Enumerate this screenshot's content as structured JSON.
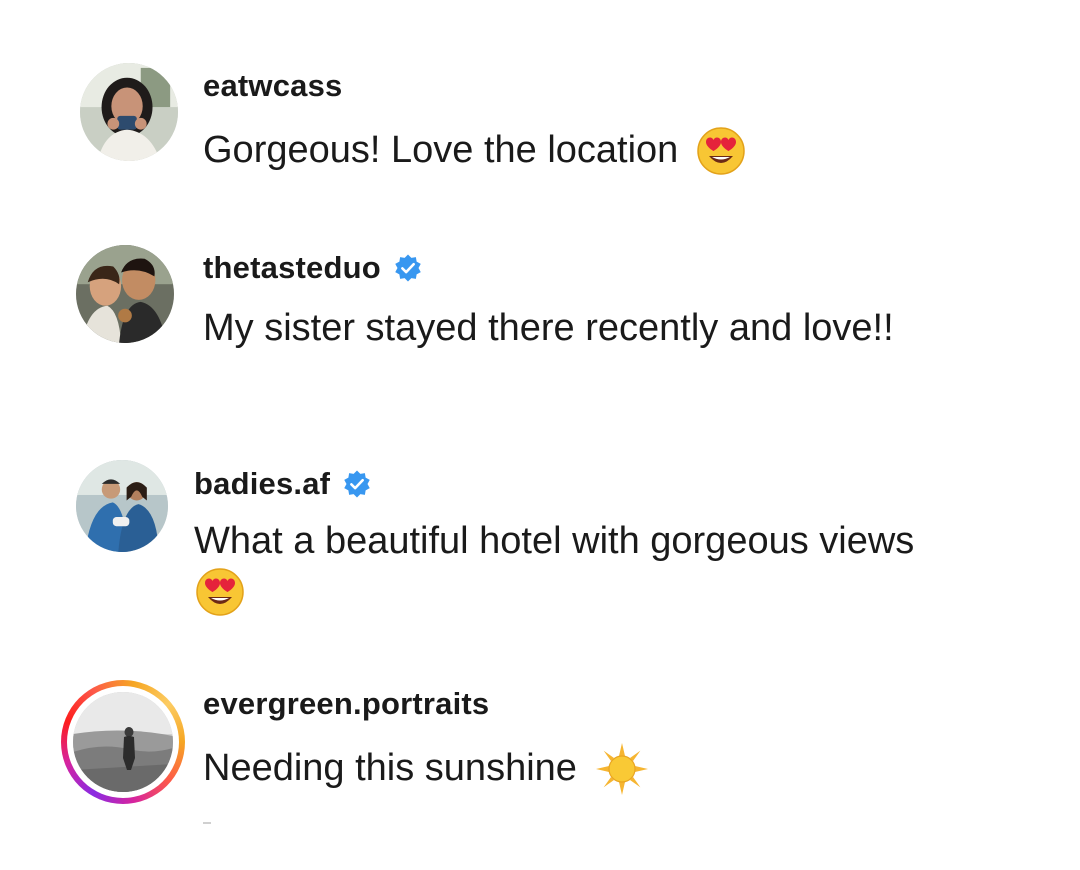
{
  "comments": [
    {
      "username": "eatwcass",
      "verified": false,
      "text": "Gorgeous! Love the location",
      "emoji": "heart-eyes-emoji",
      "story_ring": false
    },
    {
      "username": "thetasteduo",
      "verified": true,
      "text": "My sister stayed there recently and love!!",
      "emoji": null,
      "story_ring": false
    },
    {
      "username": "badies.af",
      "verified": true,
      "text": "What a beautiful hotel with gorgeous views",
      "emoji": "heart-eyes-emoji",
      "story_ring": false
    },
    {
      "username": "evergreen.portraits",
      "verified": false,
      "text": "Needing this sunshine",
      "emoji": "sun-emoji",
      "story_ring": true
    }
  ],
  "colors": {
    "verified_badge": "#3897f0",
    "text": "#1a1a1a",
    "story_ring_start": "#d6249f",
    "story_ring_end": "#fccc63"
  }
}
